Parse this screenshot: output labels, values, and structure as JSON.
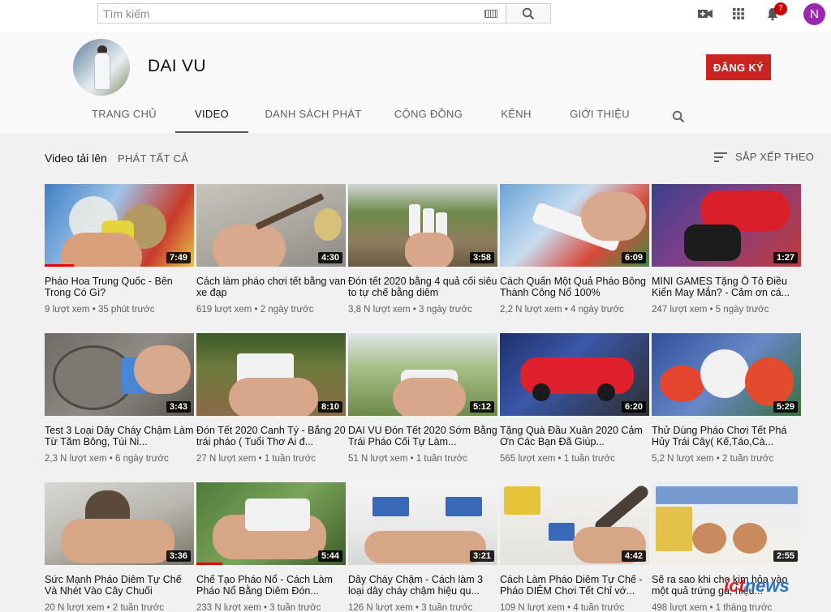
{
  "topbar": {
    "search_placeholder": "Tìm kiếm",
    "notification_count": "7",
    "account_initial": "N"
  },
  "channel": {
    "name": "DAI VU",
    "subscribe_label": "ĐĂNG KÝ",
    "tabs": [
      {
        "label": "TRANG CHỦ"
      },
      {
        "label": "VIDEO"
      },
      {
        "label": "DANH SÁCH PHÁT"
      },
      {
        "label": "CỘNG ĐỒNG"
      },
      {
        "label": "KÊNH"
      },
      {
        "label": "GIỚI THIỆU"
      }
    ]
  },
  "section": {
    "title": "Video tải lên",
    "play_all": "PHÁT TẤT CẢ",
    "sort_label": "SẮP XẾP THEO"
  },
  "videos": [
    {
      "title": "Pháo Hoa Trung Quốc - Bên Trong Có Gì?",
      "views": "9 lượt xem",
      "age": "35 phút trước",
      "duration": "7:49"
    },
    {
      "title": "Cách làm pháo chơi tết bằng van xe đạp",
      "views": "619 lượt xem",
      "age": "2 ngày trước",
      "duration": "4:30"
    },
    {
      "title": "Đón tết 2020 bằng 4 quả cối siêu to tự chế bằng diêm",
      "views": "3,8 N lượt xem",
      "age": "3 ngày trước",
      "duration": "3:58"
    },
    {
      "title": "Cách Quấn Một Quả Pháo Bông Thành Công Nổ 100%",
      "views": "2,2 N lượt xem",
      "age": "4 ngày trước",
      "duration": "6:09"
    },
    {
      "title": "MINI GAMES Tặng Ô Tô Điều Kiển May Mắn? - Cảm ơn cá...",
      "views": "247 lượt xem",
      "age": "5 ngày trước",
      "duration": "1:27"
    },
    {
      "title": "Test 3 Loại Dây Cháy Chậm Làm Từ Tăm Bông, Túi Ni...",
      "views": "2,3 N lượt xem",
      "age": "6 ngày trước",
      "duration": "3:43"
    },
    {
      "title": "Đón Tết 2020 Canh Tý - Bắng 20 trái pháo ( Tuổi Thơ Ai đ...",
      "views": "27 N lượt xem",
      "age": "1 tuần trước",
      "duration": "8:10"
    },
    {
      "title": "DAI VU Đón Tết 2020 Sớm Bằng Trái Pháo Cối Tự Làm...",
      "views": "51 N lượt xem",
      "age": "1 tuần trước",
      "duration": "5:12"
    },
    {
      "title": "Tặng Quà Đầu Xuân 2020 Cảm Ơn Các Bạn Đã Giúp...",
      "views": "565 lượt xem",
      "age": "1 tuần trước",
      "duration": "6:20"
    },
    {
      "title": "Thử Dùng Pháo Chơi Tết Phá Hủy Trái Cây( Kế,Táo,Cà...",
      "views": "5,2 N lượt xem",
      "age": "2 tuần trước",
      "duration": "5:29"
    },
    {
      "title": "Sức Mạnh Pháo Diêm Tự Chế Và Nhét Vào Cây Chuối",
      "views": "20 N lượt xem",
      "age": "2 tuần trước",
      "duration": "3:36"
    },
    {
      "title": "Chế Tạo Pháo Nổ - Cách Làm Pháo Nổ Bằng Diêm Đón...",
      "views": "233 N lượt xem",
      "age": "3 tuần trước",
      "duration": "5:44"
    },
    {
      "title": "Dây Cháy Chậm - Cách làm 3 loại dây cháy chậm hiệu qu...",
      "views": "126 N lượt xem",
      "age": "3 tuần trước",
      "duration": "3:21"
    },
    {
      "title": "Cách Làm Pháo Diêm Tự Chế - Pháo DIÊM Chơi Tết Chỉ vớ...",
      "views": "109 N lượt xem",
      "age": "4 tuần trước",
      "duration": "4:42"
    },
    {
      "title": "Sẽ ra sao khi cho kim hỏa vào một quả trứng gà, hiệu...",
      "views": "498 lượt xem",
      "age": "1 tháng trước",
      "duration": "2:55"
    }
  ],
  "watermark": {
    "part1": "ict",
    "part2": "news"
  }
}
